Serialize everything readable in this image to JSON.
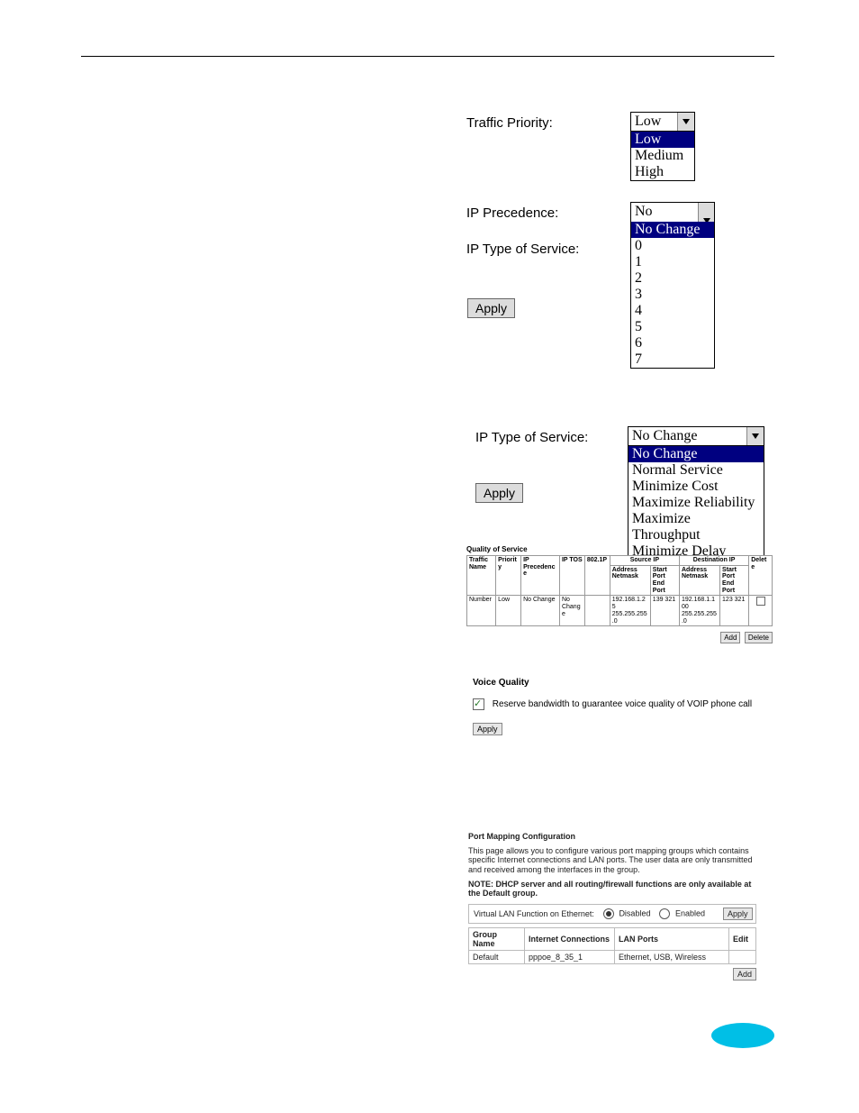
{
  "priority_section": {
    "traffic_priority_label": "Traffic Priority:",
    "ip_precedence_label": "IP Precedence:",
    "ip_tos_label": "IP Type of Service:",
    "apply_label": "Apply",
    "traffic_priority": {
      "selected": "Low",
      "options": [
        "Low",
        "Medium",
        "High"
      ]
    },
    "ip_precedence": {
      "selected": "No Change",
      "options": [
        "No Change",
        "0",
        "1",
        "2",
        "3",
        "4",
        "5",
        "6",
        "7"
      ]
    }
  },
  "tos_section": {
    "ip_tos_label": "IP Type of Service:",
    "apply_label": "Apply",
    "ip_tos": {
      "selected": "No Change",
      "options": [
        "No Change",
        "Normal Service",
        "Minimize Cost",
        "Maximize Reliability",
        "Maximize Throughput",
        "Minimize Delay"
      ]
    }
  },
  "qos_table": {
    "title": "Quality of Service",
    "headers": {
      "traffic_name": "Traffic Name",
      "priority": "Priority",
      "ip_precedence": "IP Precedence",
      "ip_tos": "IP TOS",
      "p8021": "802.1P",
      "source_ip": "Source IP",
      "destination_ip": "Destination IP",
      "address_netmask": "Address Netmask",
      "start_end_port": "Start Port End Port",
      "delete": "Delete"
    },
    "row": {
      "traffic_name": "Number",
      "priority": "Low",
      "ip_precedence": "No Change",
      "ip_tos": "No Change",
      "p8021": "",
      "src_addr": "192.168.1.25 255.255.255.0",
      "src_port": "139 321",
      "dst_addr": "192.168.1.100 255.255.255.0",
      "dst_port": "123 321",
      "delete_checked": false
    },
    "add_label": "Add",
    "delete_label": "Delete"
  },
  "voice_quality": {
    "title": "Voice Quality",
    "checkbox_label": "Reserve bandwidth to guarantee voice quality of VOIP phone call",
    "apply_label": "Apply"
  },
  "port_mapping": {
    "title": "Port Mapping Configuration",
    "para": "This page allows you to configure various port mapping groups which contains specific Internet connections and LAN ports. The user data are only transmitted and received among the interfaces in the group.",
    "note": "NOTE: DHCP server and all routing/firewall functions are only available at the Default group.",
    "vlan_label": "Virtual LAN Function on Ethernet:",
    "disabled_label": "Disabled",
    "enabled_label": "Enabled",
    "apply_label": "Apply",
    "headers": {
      "group": "Group Name",
      "internet": "Internet Connections",
      "lan": "LAN Ports",
      "edit": "Edit"
    },
    "row": {
      "group": "Default",
      "internet": "pppoe_8_35_1",
      "lan": "Ethernet, USB, Wireless",
      "edit": ""
    },
    "add_label": "Add"
  }
}
